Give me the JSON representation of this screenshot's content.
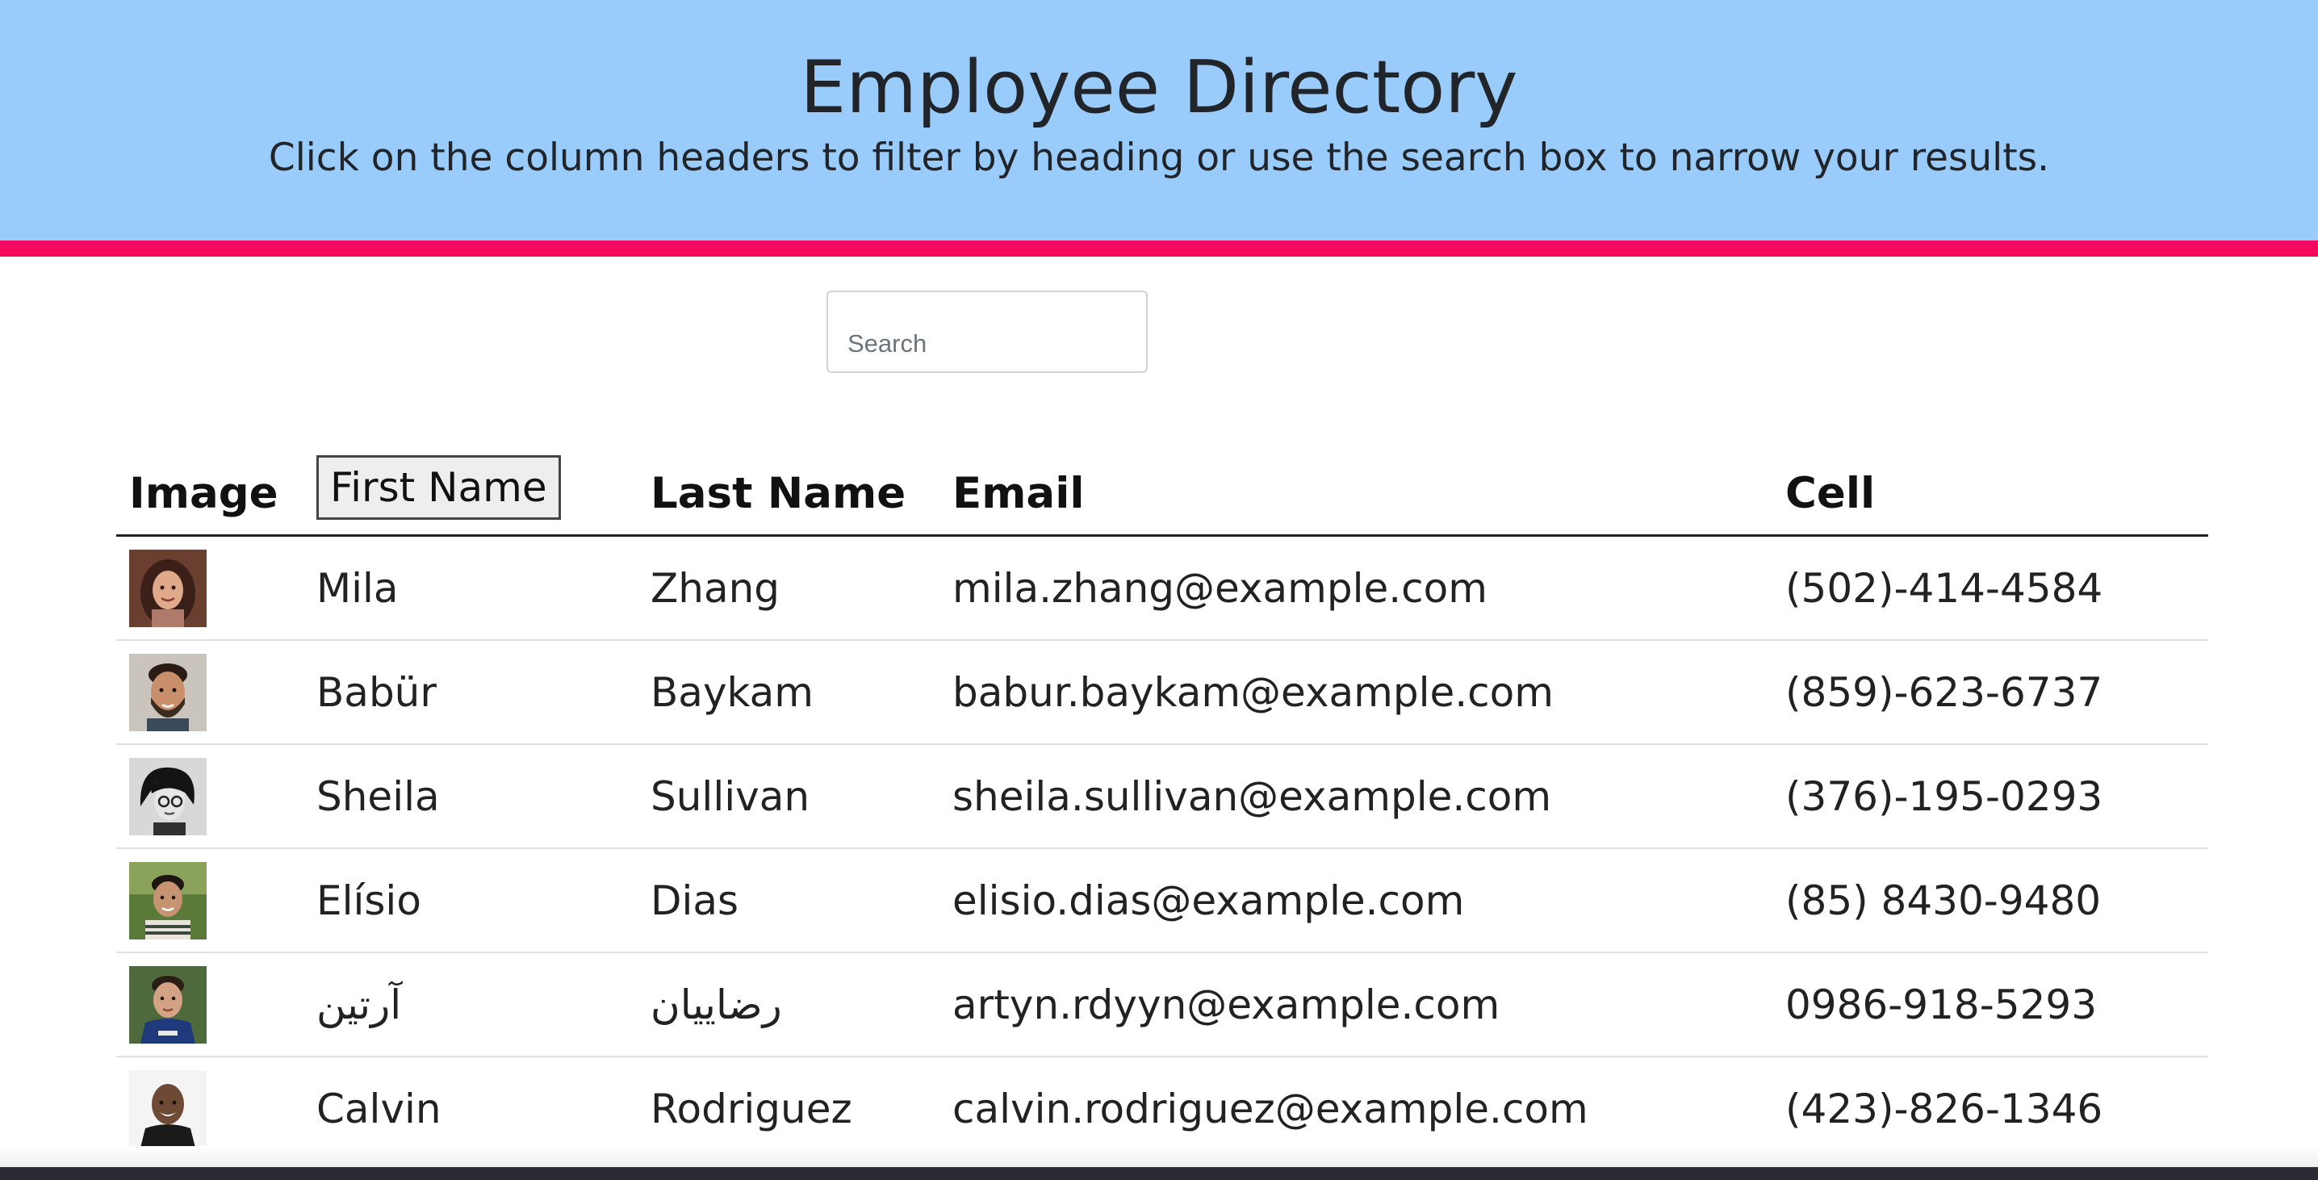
{
  "header": {
    "title": "Employee Directory",
    "subtitle": "Click on the column headers to filter by heading or use the search box to narrow your results."
  },
  "colors": {
    "banner_bg": "#99ccfb",
    "banner_stripe": "#f5095e"
  },
  "search": {
    "placeholder": "Search",
    "value": ""
  },
  "table": {
    "columns": [
      {
        "key": "image",
        "label": "Image",
        "is_button": false
      },
      {
        "key": "first",
        "label": "First Name",
        "is_button": true
      },
      {
        "key": "last",
        "label": "Last Name",
        "is_button": false
      },
      {
        "key": "email",
        "label": "Email",
        "is_button": false
      },
      {
        "key": "cell",
        "label": "Cell",
        "is_button": false
      }
    ],
    "rows": [
      {
        "avatar": "avatar-woman-long-hair",
        "first": "Mila",
        "last": "Zhang",
        "email": "mila.zhang@example.com",
        "cell": "(502)-414-4584"
      },
      {
        "avatar": "avatar-man-beard",
        "first": "Babür",
        "last": "Baykam",
        "email": "babur.baykam@example.com",
        "cell": "(859)-623-6737"
      },
      {
        "avatar": "avatar-woman-glasses-bw",
        "first": "Sheila",
        "last": "Sullivan",
        "email": "sheila.sullivan@example.com",
        "cell": "(376)-195-0293"
      },
      {
        "avatar": "avatar-man-outdoors",
        "first": "Elísio",
        "last": "Dias",
        "email": "elisio.dias@example.com",
        "cell": "(85) 8430-9480"
      },
      {
        "avatar": "avatar-man-blue-shirt",
        "first": "آرتین",
        "last": "رضاییان",
        "email": "artyn.rdyyn@example.com",
        "cell": "0986-918-5293"
      },
      {
        "avatar": "avatar-man-smiling",
        "first": "Calvin",
        "last": "Rodriguez",
        "email": "calvin.rodriguez@example.com",
        "cell": "(423)-826-1346"
      }
    ]
  }
}
